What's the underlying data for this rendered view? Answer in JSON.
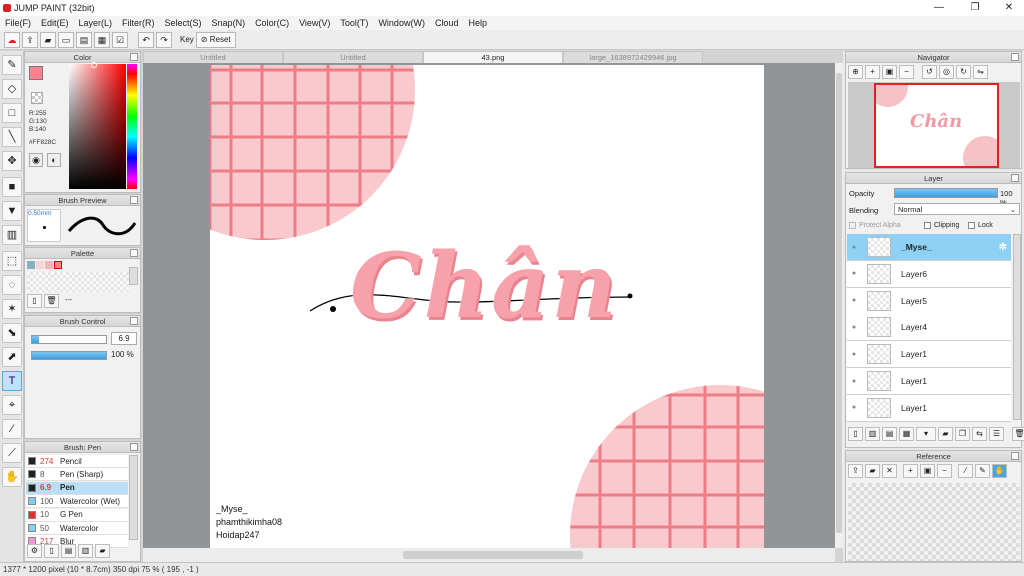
{
  "window": {
    "title": "JUMP PAINT (32bit)",
    "minimize": "—",
    "maximize": "❐",
    "close": "✕"
  },
  "menu": [
    "File(F)",
    "Edit(E)",
    "Layer(L)",
    "Filter(R)",
    "Select(S)",
    "Snap(N)",
    "Color(C)",
    "View(V)",
    "Tool(T)",
    "Window(W)",
    "Cloud",
    "Help"
  ],
  "toolbar": {
    "key_label": "Key",
    "reset_label": "Reset"
  },
  "tabs": [
    {
      "label": "Untitled",
      "active": false
    },
    {
      "label": "Untitled",
      "active": false
    },
    {
      "label": "43.png",
      "active": true
    },
    {
      "label": "large_1638972429946.jpg",
      "active": false
    }
  ],
  "color_panel": {
    "title": "Color",
    "r": "R:255",
    "g": "G:130",
    "b": "B:140",
    "hex": "#FF828C",
    "fg": "#FF828C",
    "bg": "#FFFFFF"
  },
  "brush_preview": {
    "title": "Brush Preview",
    "size": "0.50mm"
  },
  "palette": {
    "title": "Palette",
    "swatches": [
      "#8ab0bd",
      "#f2d6d8",
      "#f4b5bb",
      "#ff828c"
    ],
    "more": "---"
  },
  "brush_control": {
    "title": "Brush Control",
    "size": "6.9",
    "opacity": "100 %",
    "size_fill": 0.1,
    "opacity_fill": 1.0
  },
  "brush_list": {
    "title": "Brush: Pen",
    "items": [
      {
        "size": "274",
        "name": "Pencil",
        "color": "#222222",
        "size_red": true
      },
      {
        "size": "8",
        "name": "Pen (Sharp)",
        "color": "#222222",
        "size_red": false
      },
      {
        "size": "6.9",
        "name": "Pen",
        "color": "#222222",
        "size_red": true,
        "selected": true
      },
      {
        "size": "100",
        "name": "Watercolor (Wet)",
        "color": "#7fd0f0",
        "size_red": false
      },
      {
        "size": "10",
        "name": "G Pen",
        "color": "#e03030",
        "size_red": false
      },
      {
        "size": "50",
        "name": "Watercolor",
        "color": "#7fd0f0",
        "size_red": false
      },
      {
        "size": "217",
        "name": "Blur",
        "color": "#f29ad0",
        "size_red": true
      }
    ]
  },
  "navigator": {
    "title": "Navigator"
  },
  "layer_panel": {
    "title": "Layer",
    "opacity_label": "Opacity",
    "opacity_value": "100 %",
    "blending_label": "Blending",
    "blending_value": "Normal",
    "protect_alpha": "Protect Alpha",
    "clipping": "Clipping",
    "lock": "Lock",
    "layers": [
      "_Myse_",
      "Layer6",
      "Layer5",
      "Layer4",
      "Layer1",
      "Layer1",
      "Layer1"
    ]
  },
  "reference": {
    "title": "Reference"
  },
  "artwork": {
    "title_text": "Chân",
    "signature_lines": [
      "_Myse_",
      "phamthikimha08",
      "Hoidap247"
    ]
  },
  "status": {
    "text": "1377 * 1200 pixel  (10 * 8.7cm)  350 dpi   75 %   ( 195 , -1 )"
  }
}
